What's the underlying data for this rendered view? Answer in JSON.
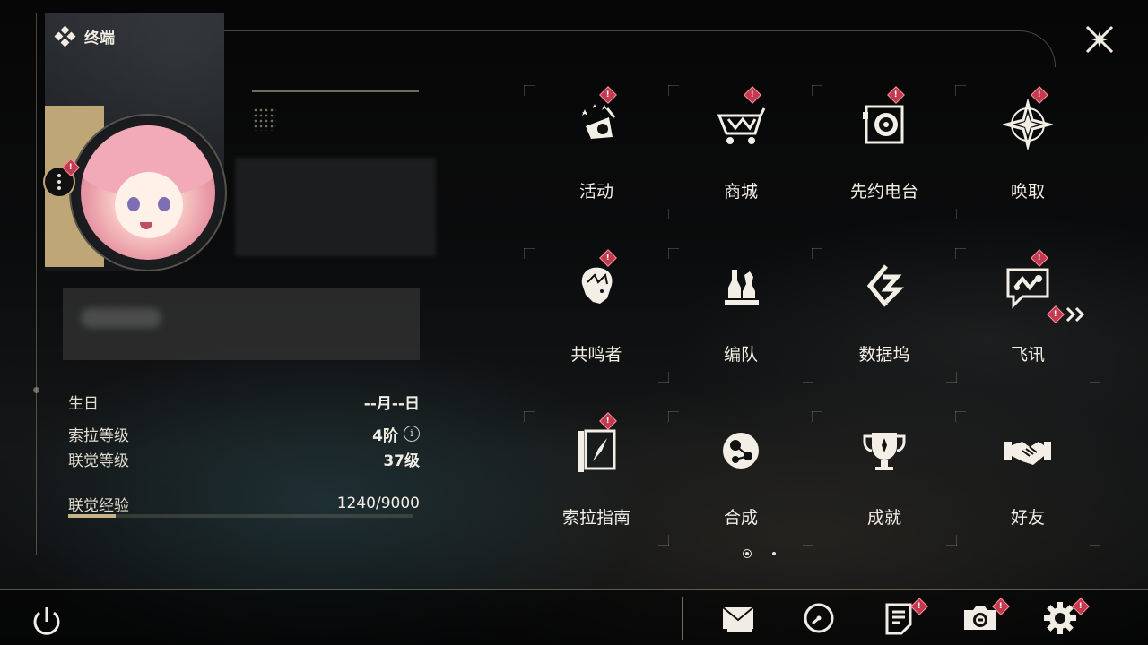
{
  "header": {
    "title": "终端"
  },
  "profile": {
    "birthday_label": "生日",
    "birthday_value": "--月--日",
    "sola_level_label": "索拉等级",
    "sola_level_value": "4阶",
    "info_icon": "i",
    "union_level_label": "联觉等级",
    "union_level_value": "37级",
    "union_exp_label": "联觉经验",
    "union_exp_value": "1240/9000",
    "union_exp_progress": 0.1378
  },
  "menu": {
    "items": [
      {
        "label": "活动",
        "icon": "event-icon",
        "badge": true
      },
      {
        "label": "商城",
        "icon": "shop-cart-icon",
        "badge": true
      },
      {
        "label": "先约电台",
        "icon": "radio-icon",
        "badge": true
      },
      {
        "label": "唤取",
        "icon": "convene-star-icon",
        "badge": true
      },
      {
        "label": "共鸣者",
        "icon": "resonator-icon",
        "badge": true
      },
      {
        "label": "编队",
        "icon": "team-chess-icon",
        "badge": false
      },
      {
        "label": "数据坞",
        "icon": "data-bank-icon",
        "badge": false
      },
      {
        "label": "飞讯",
        "icon": "message-icon",
        "badge": true
      },
      {
        "label": "索拉指南",
        "icon": "guidebook-icon",
        "badge": true
      },
      {
        "label": "合成",
        "icon": "synthesis-icon",
        "badge": false
      },
      {
        "label": "成就",
        "icon": "trophy-icon",
        "badge": false
      },
      {
        "label": "好友",
        "icon": "handshake-icon",
        "badge": false
      }
    ],
    "page_current": 1,
    "page_total": 2
  },
  "badge_symbol": "!",
  "colors": {
    "accent_gold": "#bfa677",
    "badge_red": "#c23a4e",
    "text_light": "#f3efe6"
  },
  "bottom_bar": {
    "icons": [
      "power-icon",
      "mail-icon",
      "clock-icon",
      "notice-icon",
      "camera-icon",
      "settings-gear-icon"
    ]
  }
}
